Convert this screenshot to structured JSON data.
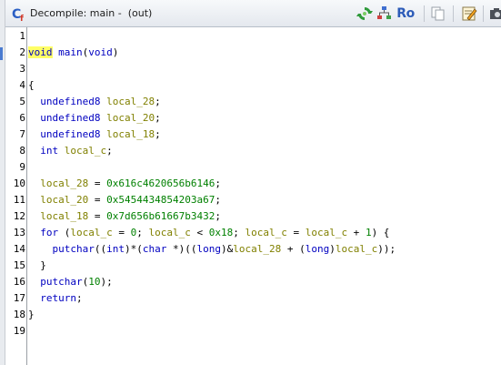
{
  "window": {
    "title": "Decompile: main -  (out)",
    "ro_label": "Ro"
  },
  "toolbar": {
    "icons": [
      "refresh-icon",
      "graph-icon",
      "ro-read-only-toggle",
      "copy-icon",
      "edit-icon",
      "camera-icon"
    ]
  },
  "colors": {
    "keyword": "#0000c0",
    "variable": "#808000",
    "number": "#008000",
    "highlight": "#ffff66"
  },
  "editor": {
    "line_numbers": [
      "1",
      "2",
      "3",
      "4",
      "5",
      "6",
      "7",
      "8",
      "9",
      "10",
      "11",
      "12",
      "13",
      "14",
      "15",
      "16",
      "17",
      "18",
      "19"
    ],
    "lines": [
      [],
      [
        {
          "t": "void",
          "c": "hl kw"
        },
        {
          "t": " ",
          "c": "plain"
        },
        {
          "t": "main",
          "c": "fn"
        },
        {
          "t": "(",
          "c": "plain"
        },
        {
          "t": "void",
          "c": "kw"
        },
        {
          "t": ")",
          "c": "plain"
        }
      ],
      [],
      [
        {
          "t": "{",
          "c": "plain"
        }
      ],
      [
        {
          "t": "  ",
          "c": "plain"
        },
        {
          "t": "undefined8",
          "c": "kw"
        },
        {
          "t": " ",
          "c": "plain"
        },
        {
          "t": "local_28",
          "c": "var"
        },
        {
          "t": ";",
          "c": "plain"
        }
      ],
      [
        {
          "t": "  ",
          "c": "plain"
        },
        {
          "t": "undefined8",
          "c": "kw"
        },
        {
          "t": " ",
          "c": "plain"
        },
        {
          "t": "local_20",
          "c": "var"
        },
        {
          "t": ";",
          "c": "plain"
        }
      ],
      [
        {
          "t": "  ",
          "c": "plain"
        },
        {
          "t": "undefined8",
          "c": "kw"
        },
        {
          "t": " ",
          "c": "plain"
        },
        {
          "t": "local_18",
          "c": "var"
        },
        {
          "t": ";",
          "c": "plain"
        }
      ],
      [
        {
          "t": "  ",
          "c": "plain"
        },
        {
          "t": "int",
          "c": "kw"
        },
        {
          "t": " ",
          "c": "plain"
        },
        {
          "t": "local_c",
          "c": "var"
        },
        {
          "t": ";",
          "c": "plain"
        }
      ],
      [],
      [
        {
          "t": "  ",
          "c": "plain"
        },
        {
          "t": "local_28",
          "c": "var"
        },
        {
          "t": " = ",
          "c": "plain"
        },
        {
          "t": "0x616c4620656b6146",
          "c": "num"
        },
        {
          "t": ";",
          "c": "plain"
        }
      ],
      [
        {
          "t": "  ",
          "c": "plain"
        },
        {
          "t": "local_20",
          "c": "var"
        },
        {
          "t": " = ",
          "c": "plain"
        },
        {
          "t": "0x5454434854203a67",
          "c": "num"
        },
        {
          "t": ";",
          "c": "plain"
        }
      ],
      [
        {
          "t": "  ",
          "c": "plain"
        },
        {
          "t": "local_18",
          "c": "var"
        },
        {
          "t": " = ",
          "c": "plain"
        },
        {
          "t": "0x7d656b61667b3432",
          "c": "num"
        },
        {
          "t": ";",
          "c": "plain"
        }
      ],
      [
        {
          "t": "  ",
          "c": "plain"
        },
        {
          "t": "for",
          "c": "kw"
        },
        {
          "t": " (",
          "c": "plain"
        },
        {
          "t": "local_c",
          "c": "var"
        },
        {
          "t": " = ",
          "c": "plain"
        },
        {
          "t": "0",
          "c": "num"
        },
        {
          "t": "; ",
          "c": "plain"
        },
        {
          "t": "local_c",
          "c": "var"
        },
        {
          "t": " < ",
          "c": "plain"
        },
        {
          "t": "0x18",
          "c": "num"
        },
        {
          "t": "; ",
          "c": "plain"
        },
        {
          "t": "local_c",
          "c": "var"
        },
        {
          "t": " = ",
          "c": "plain"
        },
        {
          "t": "local_c",
          "c": "var"
        },
        {
          "t": " + ",
          "c": "plain"
        },
        {
          "t": "1",
          "c": "num"
        },
        {
          "t": ") {",
          "c": "plain"
        }
      ],
      [
        {
          "t": "    ",
          "c": "plain"
        },
        {
          "t": "putchar",
          "c": "fn"
        },
        {
          "t": "((",
          "c": "plain"
        },
        {
          "t": "int",
          "c": "kw"
        },
        {
          "t": ")*(",
          "c": "plain"
        },
        {
          "t": "char",
          "c": "kw"
        },
        {
          "t": " *)((",
          "c": "plain"
        },
        {
          "t": "long",
          "c": "kw"
        },
        {
          "t": ")&",
          "c": "plain"
        },
        {
          "t": "local_28",
          "c": "var"
        },
        {
          "t": " + (",
          "c": "plain"
        },
        {
          "t": "long",
          "c": "kw"
        },
        {
          "t": ")",
          "c": "plain"
        },
        {
          "t": "local_c",
          "c": "var"
        },
        {
          "t": "));",
          "c": "plain"
        }
      ],
      [
        {
          "t": "  }",
          "c": "plain"
        }
      ],
      [
        {
          "t": "  ",
          "c": "plain"
        },
        {
          "t": "putchar",
          "c": "fn"
        },
        {
          "t": "(",
          "c": "plain"
        },
        {
          "t": "10",
          "c": "num"
        },
        {
          "t": ");",
          "c": "plain"
        }
      ],
      [
        {
          "t": "  ",
          "c": "plain"
        },
        {
          "t": "return",
          "c": "kw"
        },
        {
          "t": ";",
          "c": "plain"
        }
      ],
      [
        {
          "t": "}",
          "c": "plain"
        }
      ],
      []
    ]
  }
}
